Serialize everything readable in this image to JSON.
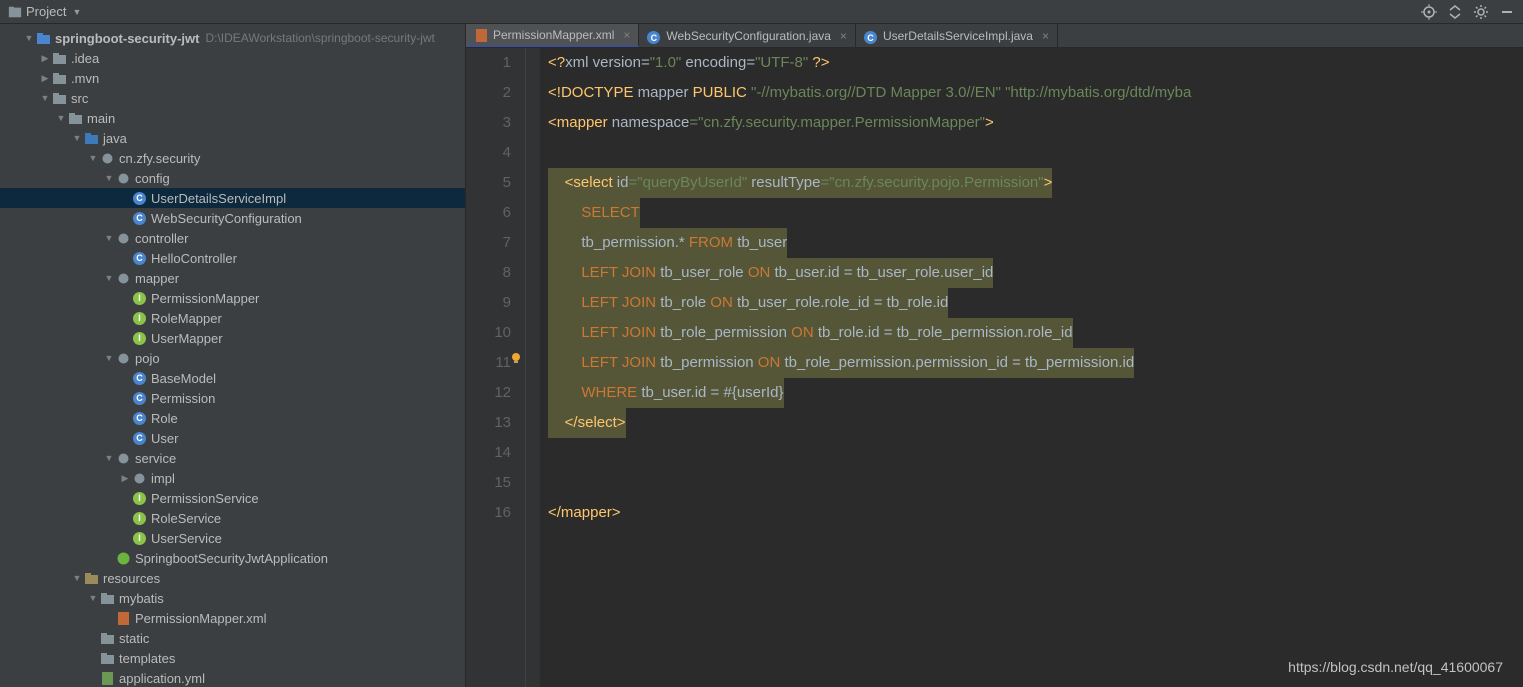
{
  "project_label": "Project",
  "root": {
    "name": "springboot-security-jwt",
    "path": "D:\\IDEAWorkstation\\springboot-security-jwt"
  },
  "tree": [
    {
      "d": 1,
      "a": "▼",
      "i": "module",
      "name": "springboot-security-jwt",
      "bold": true,
      "path": "D:\\IDEAWorkstation\\springboot-security-jwt"
    },
    {
      "d": 2,
      "a": "▶",
      "i": "folder",
      "name": ".idea"
    },
    {
      "d": 2,
      "a": "▶",
      "i": "folder",
      "name": ".mvn"
    },
    {
      "d": 2,
      "a": "▼",
      "i": "folder",
      "name": "src"
    },
    {
      "d": 3,
      "a": "▼",
      "i": "folder",
      "name": "main"
    },
    {
      "d": 4,
      "a": "▼",
      "i": "srcfolder",
      "name": "java"
    },
    {
      "d": 5,
      "a": "▼",
      "i": "pkg",
      "name": "cn.zfy.security"
    },
    {
      "d": 6,
      "a": "▼",
      "i": "pkg",
      "name": "config"
    },
    {
      "d": 7,
      "a": "",
      "i": "class",
      "name": "UserDetailsServiceImpl",
      "selected": true
    },
    {
      "d": 7,
      "a": "",
      "i": "class",
      "name": "WebSecurityConfiguration"
    },
    {
      "d": 6,
      "a": "▼",
      "i": "pkg",
      "name": "controller"
    },
    {
      "d": 7,
      "a": "",
      "i": "class",
      "name": "HelloController"
    },
    {
      "d": 6,
      "a": "▼",
      "i": "pkg",
      "name": "mapper"
    },
    {
      "d": 7,
      "a": "",
      "i": "iface",
      "name": "PermissionMapper"
    },
    {
      "d": 7,
      "a": "",
      "i": "iface",
      "name": "RoleMapper"
    },
    {
      "d": 7,
      "a": "",
      "i": "iface",
      "name": "UserMapper"
    },
    {
      "d": 6,
      "a": "▼",
      "i": "pkg",
      "name": "pojo"
    },
    {
      "d": 7,
      "a": "",
      "i": "class",
      "name": "BaseModel"
    },
    {
      "d": 7,
      "a": "",
      "i": "class",
      "name": "Permission"
    },
    {
      "d": 7,
      "a": "",
      "i": "class",
      "name": "Role"
    },
    {
      "d": 7,
      "a": "",
      "i": "class",
      "name": "User"
    },
    {
      "d": 6,
      "a": "▼",
      "i": "pkg",
      "name": "service"
    },
    {
      "d": 7,
      "a": "▶",
      "i": "pkg",
      "name": "impl"
    },
    {
      "d": 7,
      "a": "",
      "i": "iface",
      "name": "PermissionService"
    },
    {
      "d": 7,
      "a": "",
      "i": "iface",
      "name": "RoleService"
    },
    {
      "d": 7,
      "a": "",
      "i": "iface",
      "name": "UserService"
    },
    {
      "d": 6,
      "a": "",
      "i": "boot",
      "name": "SpringbootSecurityJwtApplication"
    },
    {
      "d": 4,
      "a": "▼",
      "i": "resfolder",
      "name": "resources"
    },
    {
      "d": 5,
      "a": "▼",
      "i": "folder",
      "name": "mybatis"
    },
    {
      "d": 6,
      "a": "",
      "i": "xml",
      "name": "PermissionMapper.xml"
    },
    {
      "d": 5,
      "a": "",
      "i": "folder",
      "name": "static"
    },
    {
      "d": 5,
      "a": "",
      "i": "folder",
      "name": "templates"
    },
    {
      "d": 5,
      "a": "",
      "i": "yml",
      "name": "application.yml"
    }
  ],
  "tabs": [
    {
      "name": "PermissionMapper.xml",
      "icon": "xml",
      "active": true
    },
    {
      "name": "WebSecurityConfiguration.java",
      "icon": "class",
      "active": false
    },
    {
      "name": "UserDetailsServiceImpl.java",
      "icon": "class",
      "active": false
    }
  ],
  "line_numbers": [
    "1",
    "2",
    "3",
    "4",
    "5",
    "6",
    "7",
    "8",
    "9",
    "10",
    "11",
    "12",
    "13",
    "14",
    "15",
    "16"
  ],
  "code": {
    "l1": {
      "a": "<?",
      "b": "xml version",
      "c": "=",
      "d": "\"1.0\"",
      "e": " encoding",
      "f": "=",
      "g": "\"UTF-8\"",
      "h": " ?>"
    },
    "l2": {
      "a": "<!",
      "b": "DOCTYPE ",
      "c": "mapper ",
      "d": "PUBLIC ",
      "e": "\"-//mybatis.org//DTD Mapper 3.0//EN\" \"http://mybatis.org/dtd/myba"
    },
    "l3": {
      "a": "<mapper ",
      "b": "namespace",
      "c": "=",
      "d": "\"cn.zfy.security.mapper.PermissionMapper\"",
      "e": ">"
    },
    "l5": {
      "a": "    <select ",
      "b": "id",
      "c": "=",
      "d": "\"queryByUserId\"",
      "e": " resultType",
      "f": "=",
      "g": "\"cn.zfy.security.pojo.Permission\"",
      "h": ">"
    },
    "l6": {
      "a": "        ",
      "b": "SELECT"
    },
    "l7": {
      "a": "        tb_permission.* ",
      "b": "FROM ",
      "c": "tb_user"
    },
    "l8": {
      "a": "        ",
      "b": "LEFT JOIN ",
      "c": "tb_user_role ",
      "d": "ON ",
      "e": "tb_user.id = tb_user_role.user_id"
    },
    "l9": {
      "a": "        ",
      "b": "LEFT JOIN ",
      "c": "tb_role ",
      "d": "ON ",
      "e": "tb_user_role.role_id = tb_role.id"
    },
    "l10": {
      "a": "        ",
      "b": "LEFT JOIN ",
      "c": "tb_role_permission ",
      "d": "ON ",
      "e": "tb_role.id = tb_role_permission.role_id"
    },
    "l11": {
      "a": "        ",
      "b": "LEFT JOIN ",
      "c": "tb_permission ",
      "d": "ON ",
      "e": "tb_role_permission.permission_id = tb_permission.id"
    },
    "l12": {
      "a": "        ",
      "b": "WHERE ",
      "c": "tb_user.id = #{userId}"
    },
    "l13": {
      "a": "    </select>"
    },
    "l16": {
      "a": "</mapper>"
    }
  },
  "watermark": "https://blog.csdn.net/qq_41600067"
}
